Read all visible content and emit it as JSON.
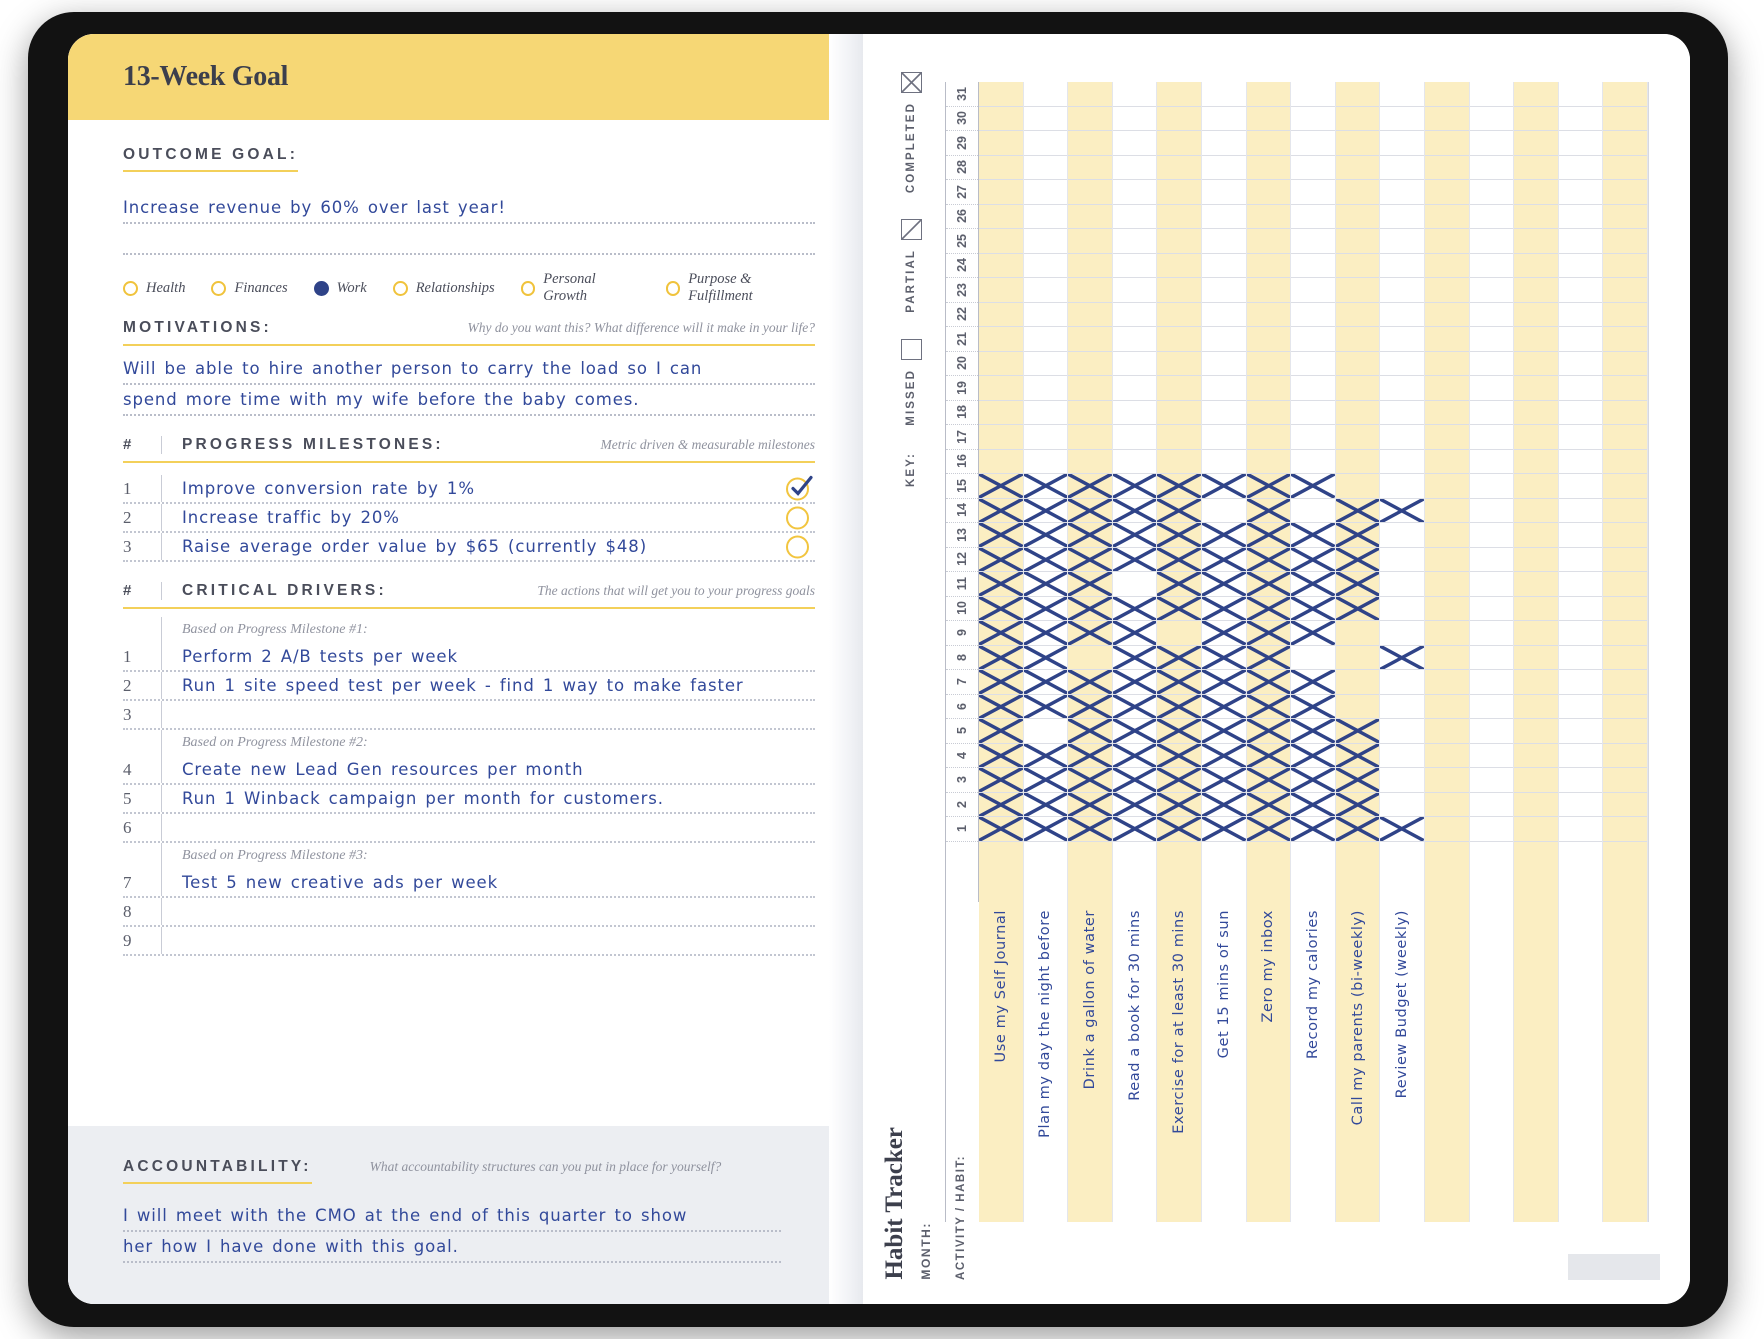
{
  "left_page": {
    "banner_title": "13-Week Goal",
    "outcome": {
      "heading": "OUTCOME GOAL:",
      "value": "Increase revenue by 60% over last year!"
    },
    "life_areas": [
      {
        "label": "Health",
        "selected": false
      },
      {
        "label": "Finances",
        "selected": false
      },
      {
        "label": "Work",
        "selected": true
      },
      {
        "label": "Relationships",
        "selected": false
      },
      {
        "label": "Personal Growth",
        "selected": false
      },
      {
        "label": "Purpose & Fulfillment",
        "selected": false
      }
    ],
    "motivations": {
      "heading": "MOTIVATIONS:",
      "hint": "Why do you want this? What difference will it make in your life?",
      "line1": "Will be able to hire another person to carry the load so I can",
      "line2": "spend more time with my wife before the baby comes."
    },
    "milestones": {
      "num_header": "#",
      "heading": "PROGRESS MILESTONES:",
      "hint": "Metric driven & measurable milestones",
      "rows": [
        {
          "num": "1",
          "text": "Improve conversion rate by 1%",
          "checked": true
        },
        {
          "num": "2",
          "text": "Increase traffic by 20%",
          "checked": false
        },
        {
          "num": "3",
          "text": "Raise average order value by $65 (currently $48)",
          "checked": false
        }
      ]
    },
    "drivers": {
      "num_header": "#",
      "heading": "CRITICAL DRIVERS:",
      "hint": "The actions that will get you to your progress goals",
      "groups": [
        {
          "subhead": "Based on Progress Milestone #1:",
          "rows": [
            {
              "num": "1",
              "text": "Perform 2 A/B tests per week"
            },
            {
              "num": "2",
              "text": "Run 1 site speed test per week - find 1 way to make faster"
            },
            {
              "num": "3",
              "text": ""
            }
          ]
        },
        {
          "subhead": "Based on Progress Milestone #2:",
          "rows": [
            {
              "num": "4",
              "text": "Create new Lead Gen resources per month"
            },
            {
              "num": "5",
              "text": "Run 1 Winback campaign per month for customers."
            },
            {
              "num": "6",
              "text": ""
            }
          ]
        },
        {
          "subhead": "Based on Progress Milestone #3:",
          "rows": [
            {
              "num": "7",
              "text": "Test 5 new creative ads per week"
            },
            {
              "num": "8",
              "text": ""
            },
            {
              "num": "9",
              "text": ""
            }
          ]
        }
      ]
    },
    "accountability": {
      "heading": "ACCOUNTABILITY:",
      "hint": "What accountability structures can you put in place for yourself?",
      "line1": "I will meet with the CMO at the end of this quarter to show",
      "line2": "her how I have done with this goal."
    }
  },
  "right_page": {
    "title": "Habit Tracker",
    "month_label": "MONTH:",
    "activity_label": "ACTIVITY / HABIT:",
    "key": {
      "word": "KEY:",
      "items": [
        {
          "label": "COMPLETED",
          "glyph": "x"
        },
        {
          "label": "PARTIAL",
          "glyph": "slash"
        },
        {
          "label": "MISSED",
          "glyph": "empty"
        }
      ]
    },
    "days": [
      31,
      30,
      29,
      28,
      27,
      26,
      25,
      24,
      23,
      22,
      21,
      20,
      19,
      18,
      17,
      16,
      15,
      14,
      13,
      12,
      11,
      10,
      9,
      8,
      7,
      6,
      5,
      4,
      3,
      2,
      1
    ],
    "habits": [
      {
        "label": "Use my Self Journal",
        "tinted": true
      },
      {
        "label": "Plan my day the night before",
        "tinted": false
      },
      {
        "label": "Drink a gallon of water",
        "tinted": true
      },
      {
        "label": "Read a book for 30 mins",
        "tinted": false
      },
      {
        "label": "Exercise for at least 30 mins",
        "tinted": true
      },
      {
        "label": "Get 15 mins of sun",
        "tinted": false
      },
      {
        "label": "Zero my inbox",
        "tinted": true
      },
      {
        "label": "Record my calories",
        "tinted": false
      },
      {
        "label": "Call my parents (bi-weekly)",
        "tinted": true
      },
      {
        "label": "Review Budget (weekly)",
        "tinted": false
      },
      {
        "label": "",
        "tinted": true
      },
      {
        "label": "",
        "tinted": false
      },
      {
        "label": "",
        "tinted": true
      },
      {
        "label": "",
        "tinted": false
      },
      {
        "label": "",
        "tinted": true
      }
    ],
    "marks": {
      "0": [
        1,
        2,
        3,
        4,
        5,
        6,
        7,
        8,
        9,
        10,
        11,
        12,
        13,
        14,
        15
      ],
      "1": [
        1,
        2,
        3,
        4,
        6,
        7,
        8,
        9,
        10,
        11,
        12,
        13,
        14,
        15
      ],
      "2": [
        1,
        2,
        3,
        4,
        5,
        6,
        7,
        9,
        10,
        11,
        12,
        13,
        14,
        15
      ],
      "3": [
        1,
        2,
        3,
        4,
        5,
        6,
        7,
        8,
        9,
        10,
        12,
        13,
        14,
        15
      ],
      "4": [
        1,
        2,
        3,
        4,
        5,
        6,
        7,
        8,
        10,
        11,
        12,
        13,
        14,
        15
      ],
      "5": [
        1,
        2,
        3,
        4,
        5,
        6,
        7,
        8,
        9,
        10,
        11,
        12,
        13,
        15
      ],
      "6": [
        1,
        2,
        3,
        4,
        5,
        6,
        7,
        8,
        9,
        10,
        11,
        12,
        13,
        14,
        15
      ],
      "7": [
        1,
        2,
        3,
        4,
        5,
        6,
        7,
        9,
        10,
        11,
        12,
        13,
        15
      ],
      "8": [
        1,
        2,
        3,
        4,
        5,
        10,
        11,
        12,
        13,
        14
      ],
      "9": [
        1,
        8,
        14
      ]
    }
  }
}
